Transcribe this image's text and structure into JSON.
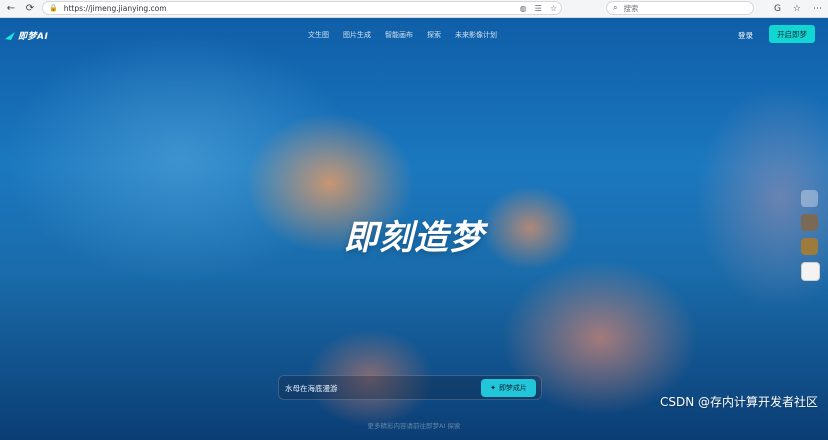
{
  "browser": {
    "url": "https://jimeng.jianying.com",
    "search_placeholder": "搜索"
  },
  "site": {
    "logo_text": "即梦AI",
    "nav": [
      "文生图",
      "图片生成",
      "智能画布",
      "探索",
      "未来影像计划"
    ],
    "login_label": "登录",
    "start_label": "开启即梦"
  },
  "hero": {
    "headline": "即刻造梦",
    "prompt_placeholder": "水母在海底漫游",
    "generate_label": "即梦成片",
    "footnote": "更多精彩内容请前往即梦AI 探索"
  },
  "watermark": "CSDN @存内计算开发者社区"
}
